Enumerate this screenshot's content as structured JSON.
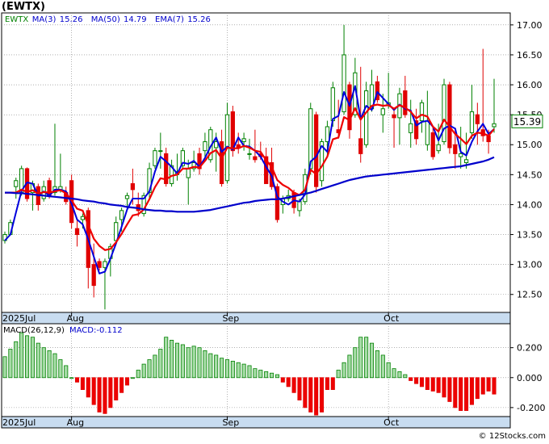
{
  "chart_data": [
    {
      "type": "candlestick",
      "ticker": "(EWTX)",
      "indicators": [
        {
          "label": "EWTX",
          "value": "",
          "color": "#008000"
        },
        {
          "label": "MA(3)",
          "value": "15.26",
          "color": "#0000cc"
        },
        {
          "label": "MA(50)",
          "value": "14.79",
          "color": "#0000cc"
        },
        {
          "label": "EMA(7)",
          "value": "15.26",
          "color": "#0000cc"
        }
      ],
      "last_price": "15.39",
      "ylim": [
        12.2,
        17.2
      ],
      "y_ticks": [
        12.5,
        13.0,
        13.5,
        14.0,
        14.5,
        15.0,
        15.5,
        16.0,
        16.5,
        17.0
      ],
      "y_tick_labels": [
        "12.50",
        "13.00",
        "13.50",
        "14.00",
        "14.50",
        "15.00",
        "15.50",
        "16.00",
        "16.50",
        "17.00"
      ],
      "x_tick_labels": [
        {
          "label": "2025Jul",
          "index": 0
        },
        {
          "label": "Aug",
          "index": 12
        },
        {
          "label": "Sep",
          "index": 40
        },
        {
          "label": "Oct",
          "index": 69
        }
      ],
      "candles": [
        [
          13.4,
          13.55,
          13.35,
          13.5
        ],
        [
          13.5,
          13.75,
          13.5,
          13.7
        ],
        [
          14.3,
          14.45,
          14.1,
          14.4
        ],
        [
          14.2,
          14.65,
          14.15,
          14.6
        ],
        [
          14.6,
          14.62,
          14.05,
          14.1
        ],
        [
          14.2,
          14.4,
          13.9,
          14.35
        ],
        [
          14.3,
          14.35,
          13.9,
          14.0
        ],
        [
          14.1,
          14.4,
          14.05,
          14.3
        ],
        [
          14.4,
          14.45,
          14.1,
          14.15
        ],
        [
          14.2,
          15.35,
          14.15,
          14.3
        ],
        [
          14.25,
          14.85,
          14.2,
          14.3
        ],
        [
          14.2,
          14.3,
          14.0,
          14.05
        ],
        [
          14.4,
          14.5,
          13.6,
          13.7
        ],
        [
          13.6,
          13.75,
          13.3,
          13.5
        ],
        [
          13.75,
          13.85,
          13.6,
          13.8
        ],
        [
          13.9,
          13.95,
          12.6,
          12.95
        ],
        [
          13.0,
          13.35,
          12.45,
          12.65
        ],
        [
          13.05,
          13.1,
          12.9,
          12.95
        ],
        [
          12.95,
          13.1,
          12.25,
          13.05
        ],
        [
          13.1,
          13.35,
          12.8,
          13.3
        ],
        [
          13.4,
          13.8,
          13.35,
          13.7
        ],
        [
          13.75,
          13.95,
          13.55,
          13.9
        ],
        [
          14.1,
          14.2,
          13.9,
          14.15
        ],
        [
          14.35,
          14.6,
          14.0,
          14.25
        ],
        [
          14.0,
          14.2,
          13.8,
          13.9
        ],
        [
          13.85,
          14.2,
          13.8,
          14.15
        ],
        [
          14.2,
          14.7,
          14.1,
          14.6
        ],
        [
          14.65,
          14.95,
          14.6,
          14.9
        ],
        [
          14.9,
          15.2,
          14.6,
          14.9
        ],
        [
          14.85,
          14.95,
          14.3,
          14.35
        ],
        [
          14.35,
          14.75,
          14.3,
          14.65
        ],
        [
          14.5,
          14.85,
          14.4,
          14.55
        ],
        [
          14.65,
          14.95,
          14.6,
          14.9
        ],
        [
          14.45,
          14.75,
          14.0,
          14.6
        ],
        [
          14.6,
          14.9,
          14.55,
          14.7
        ],
        [
          14.85,
          14.95,
          14.5,
          14.6
        ],
        [
          14.9,
          15.2,
          14.8,
          15.05
        ],
        [
          14.75,
          15.3,
          14.7,
          15.25
        ],
        [
          14.95,
          15.2,
          14.55,
          15.05
        ],
        [
          15.05,
          15.25,
          14.3,
          14.35
        ],
        [
          14.4,
          15.7,
          14.35,
          15.5
        ],
        [
          15.55,
          15.65,
          14.8,
          14.9
        ],
        [
          15.0,
          15.2,
          14.85,
          14.95
        ],
        [
          15.05,
          15.2,
          14.9,
          15.1
        ],
        [
          14.85,
          15.1,
          14.75,
          14.85
        ],
        [
          14.8,
          15.25,
          14.7,
          14.75
        ],
        [
          14.85,
          15.05,
          14.75,
          14.8
        ],
        [
          14.8,
          14.95,
          14.35,
          14.35
        ],
        [
          14.7,
          14.95,
          14.25,
          14.3
        ],
        [
          14.3,
          14.35,
          13.7,
          13.75
        ],
        [
          14.0,
          14.15,
          13.85,
          14.1
        ],
        [
          14.1,
          14.25,
          14.05,
          14.15
        ],
        [
          14.2,
          14.25,
          13.85,
          13.95
        ],
        [
          13.9,
          14.1,
          13.8,
          14.05
        ],
        [
          14.05,
          14.6,
          14.0,
          14.5
        ],
        [
          14.6,
          15.7,
          14.5,
          15.6
        ],
        [
          15.5,
          15.55,
          14.2,
          14.3
        ],
        [
          14.4,
          15.1,
          14.3,
          15.05
        ],
        [
          15.05,
          15.4,
          14.8,
          15.3
        ],
        [
          15.4,
          16.05,
          15.3,
          15.95
        ],
        [
          15.25,
          15.75,
          15.1,
          15.2
        ],
        [
          15.55,
          17.0,
          15.5,
          16.5
        ],
        [
          16.0,
          16.05,
          15.1,
          15.25
        ],
        [
          15.5,
          16.45,
          15.45,
          16.2
        ],
        [
          15.1,
          16.3,
          14.7,
          14.85
        ],
        [
          15.0,
          16.05,
          14.95,
          15.9
        ],
        [
          15.6,
          16.25,
          15.55,
          16.0
        ],
        [
          16.05,
          16.15,
          15.7,
          15.75
        ],
        [
          15.5,
          15.85,
          15.2,
          15.6
        ],
        [
          15.65,
          16.2,
          15.6,
          15.7
        ],
        [
          15.5,
          15.6,
          14.95,
          15.45
        ],
        [
          15.45,
          15.95,
          15.0,
          15.85
        ],
        [
          15.9,
          16.15,
          15.45,
          15.5
        ],
        [
          15.2,
          15.75,
          14.95,
          15.35
        ],
        [
          15.4,
          15.6,
          15.0,
          15.1
        ],
        [
          15.4,
          15.75,
          15.2,
          15.7
        ],
        [
          15.0,
          15.9,
          14.9,
          15.4
        ],
        [
          15.2,
          15.3,
          14.75,
          14.8
        ],
        [
          14.9,
          15.35,
          14.85,
          15.0
        ],
        [
          15.05,
          16.1,
          15.0,
          16.0
        ],
        [
          16.0,
          16.05,
          14.85,
          14.95
        ],
        [
          15.0,
          15.25,
          14.6,
          14.85
        ],
        [
          14.8,
          15.3,
          14.6,
          14.85
        ],
        [
          14.7,
          15.2,
          14.6,
          14.75
        ],
        [
          15.2,
          16.0,
          15.1,
          15.55
        ],
        [
          15.5,
          15.7,
          15.0,
          15.35
        ],
        [
          15.25,
          16.6,
          15.05,
          15.15
        ],
        [
          15.15,
          15.25,
          14.85,
          15.05
        ],
        [
          15.3,
          16.1,
          15.2,
          15.35
        ]
      ],
      "series": [
        {
          "name": "MA(3)",
          "color": "#0000dd",
          "values": [
            13.4,
            13.5,
            13.87,
            14.23,
            14.37,
            14.35,
            14.15,
            14.22,
            14.15,
            14.25,
            14.25,
            14.22,
            14.02,
            13.75,
            13.67,
            13.42,
            13.13,
            12.85,
            12.88,
            13.1,
            13.35,
            13.63,
            13.92,
            14.1,
            14.1,
            14.1,
            14.22,
            14.55,
            14.8,
            14.72,
            14.63,
            14.52,
            14.7,
            14.68,
            14.73,
            14.63,
            14.78,
            14.97,
            15.12,
            14.88,
            14.97,
            14.92,
            15.12,
            14.98,
            14.97,
            14.9,
            14.8,
            14.63,
            14.48,
            14.13,
            14.05,
            14.0,
            14.07,
            14.05,
            14.17,
            14.72,
            14.8,
            14.98,
            14.88,
            15.43,
            15.48,
            15.88,
            15.65,
            15.98,
            15.43,
            15.65,
            15.58,
            15.88,
            15.78,
            15.68,
            15.58,
            15.67,
            15.6,
            15.57,
            15.32,
            15.38,
            15.4,
            15.3,
            15.07,
            15.27,
            15.32,
            15.27,
            14.88,
            14.82,
            15.05,
            15.22,
            15.35,
            15.18,
            15.26
          ]
        },
        {
          "name": "EMA(7)",
          "color": "#ee0000",
          "values": [
            14.2,
            14.2,
            14.2,
            14.25,
            14.21,
            14.24,
            14.18,
            14.21,
            14.2,
            14.22,
            14.24,
            14.19,
            14.07,
            13.93,
            13.9,
            13.66,
            13.43,
            13.31,
            13.24,
            13.26,
            13.37,
            13.51,
            13.67,
            13.82,
            13.84,
            13.92,
            14.09,
            14.29,
            14.44,
            14.42,
            14.48,
            14.5,
            14.6,
            14.6,
            14.63,
            14.62,
            14.73,
            14.86,
            14.91,
            14.77,
            14.95,
            14.94,
            14.94,
            14.98,
            14.95,
            14.9,
            14.88,
            14.74,
            14.63,
            14.41,
            14.33,
            14.28,
            14.2,
            14.16,
            14.25,
            14.58,
            14.51,
            14.64,
            14.8,
            15.09,
            15.12,
            15.46,
            15.41,
            15.61,
            15.42,
            15.54,
            15.65,
            15.67,
            15.65,
            15.66,
            15.6,
            15.66,
            15.62,
            15.55,
            15.44,
            15.5,
            15.47,
            15.3,
            15.22,
            15.42,
            15.3,
            15.18,
            15.1,
            15.01,
            15.15,
            15.2,
            15.19,
            15.15,
            15.26
          ]
        },
        {
          "name": "MA(50)",
          "color": "#0000cc",
          "values": [
            14.2,
            14.2,
            14.19,
            14.19,
            14.18,
            14.17,
            14.16,
            14.15,
            14.14,
            14.13,
            14.12,
            14.11,
            14.1,
            14.09,
            14.07,
            14.06,
            14.05,
            14.03,
            14.02,
            14.0,
            13.99,
            13.98,
            13.96,
            13.95,
            13.94,
            13.92,
            13.91,
            13.9,
            13.9,
            13.89,
            13.89,
            13.88,
            13.88,
            13.88,
            13.88,
            13.89,
            13.9,
            13.91,
            13.93,
            13.95,
            13.97,
            13.99,
            14.01,
            14.03,
            14.04,
            14.06,
            14.07,
            14.08,
            14.09,
            14.09,
            14.1,
            14.12,
            14.14,
            14.16,
            14.18,
            14.2,
            14.23,
            14.26,
            14.29,
            14.32,
            14.35,
            14.38,
            14.41,
            14.43,
            14.45,
            14.47,
            14.48,
            14.49,
            14.5,
            14.51,
            14.52,
            14.53,
            14.54,
            14.55,
            14.56,
            14.57,
            14.58,
            14.59,
            14.6,
            14.61,
            14.62,
            14.63,
            14.64,
            14.66,
            14.68,
            14.7,
            14.72,
            14.75,
            14.79
          ]
        }
      ]
    },
    {
      "type": "bar",
      "title": "MACD(26,12,9)",
      "value_label": "MACD:-0.112",
      "ylim": [
        -0.26,
        0.36
      ],
      "y_ticks": [
        0.2,
        0.0,
        -0.2
      ],
      "y_tick_labels": [
        "0.200",
        "0.000",
        "-0.200"
      ],
      "x_tick_labels": [
        {
          "label": "2025Jul",
          "index": 0
        },
        {
          "label": "Aug",
          "index": 12
        },
        {
          "label": "Sep",
          "index": 40
        },
        {
          "label": "Oct",
          "index": 69
        }
      ],
      "values": [
        0.14,
        0.19,
        0.24,
        0.3,
        0.28,
        0.27,
        0.23,
        0.2,
        0.18,
        0.16,
        0.12,
        0.08,
        0.0,
        -0.03,
        -0.08,
        -0.13,
        -0.18,
        -0.23,
        -0.24,
        -0.2,
        -0.15,
        -0.1,
        -0.05,
        0.0,
        0.05,
        0.09,
        0.12,
        0.15,
        0.19,
        0.27,
        0.25,
        0.23,
        0.22,
        0.2,
        0.21,
        0.2,
        0.18,
        0.16,
        0.15,
        0.13,
        0.12,
        0.11,
        0.1,
        0.09,
        0.08,
        0.06,
        0.05,
        0.04,
        0.03,
        0.02,
        -0.03,
        -0.06,
        -0.1,
        -0.15,
        -0.2,
        -0.23,
        -0.25,
        -0.23,
        -0.08,
        -0.08,
        0.05,
        0.1,
        0.15,
        0.2,
        0.27,
        0.27,
        0.23,
        0.18,
        0.15,
        0.1,
        0.06,
        0.04,
        0.02,
        -0.02,
        -0.04,
        -0.06,
        -0.08,
        -0.09,
        -0.1,
        -0.13,
        -0.16,
        -0.2,
        -0.22,
        -0.22,
        -0.18,
        -0.14,
        -0.11,
        -0.09,
        -0.11
      ]
    }
  ],
  "watermark": "© 12Stocks.com",
  "colors": {
    "up": "#008000",
    "up_fill": "#a6dca6",
    "down": "#e00000",
    "grid": "#808080",
    "axis_band": "#c8dcf0",
    "macd_pos": "#a6dca6",
    "macd_neg": "#ee0000"
  }
}
